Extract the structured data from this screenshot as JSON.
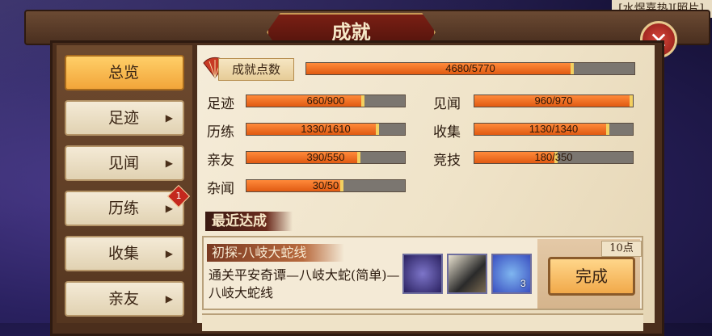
{
  "top_label": "[水煜嘉热][照片]",
  "title": "成就",
  "close_symbol": "✕",
  "sidebar": {
    "items": [
      {
        "label": "总览",
        "active": true
      },
      {
        "label": "足迹",
        "arrow": "▶"
      },
      {
        "label": "见闻",
        "arrow": "▶"
      },
      {
        "label": "历练",
        "arrow": "▶",
        "badge": "1"
      },
      {
        "label": "收集",
        "arrow": "▶"
      },
      {
        "label": "亲友",
        "arrow": "▶"
      }
    ]
  },
  "total": {
    "label": "成就点数",
    "text": "4680/5770",
    "value": 4680,
    "max": 5770
  },
  "stats": [
    {
      "label": "足迹",
      "text": "660/900",
      "value": 660,
      "max": 900
    },
    {
      "label": "见闻",
      "text": "960/970",
      "value": 960,
      "max": 970
    },
    {
      "label": "历练",
      "text": "1330/1610",
      "value": 1330,
      "max": 1610
    },
    {
      "label": "收集",
      "text": "1130/1340",
      "value": 1130,
      "max": 1340
    },
    {
      "label": "亲友",
      "text": "390/550",
      "value": 390,
      "max": 550
    },
    {
      "label": "竞技",
      "text": "180/350",
      "value": 180,
      "max": 350
    },
    {
      "label": "杂闻",
      "text": "30/50",
      "value": 30,
      "max": 50
    }
  ],
  "recent": {
    "heading": "最近达成",
    "card": {
      "title": "初探-八岐大蛇线",
      "description": "通关平安奇谭—八岐大蛇(简单)—八岐大蛇线",
      "reward_count": "3",
      "points": "10点",
      "button": "完成"
    }
  },
  "colors": {
    "bar_fill": "#e05a12",
    "bar_track": "#7b7670",
    "active_tab": "#f2a53a"
  }
}
